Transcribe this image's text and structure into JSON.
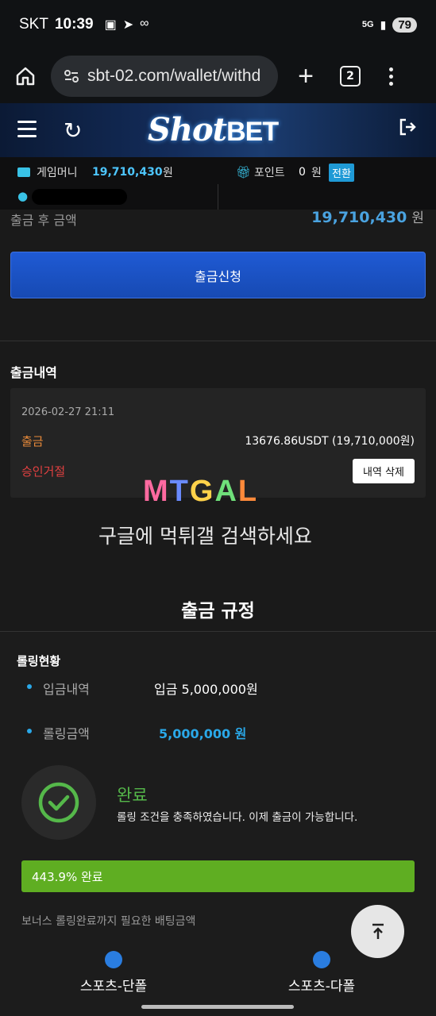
{
  "status_bar": {
    "carrier": "SKT",
    "time": "10:39",
    "network": "5G",
    "battery": "79"
  },
  "browser": {
    "url": "sbt-02.com/wallet/withd",
    "tab_count": "2"
  },
  "header": {
    "logo_shot": "Shot",
    "logo_bet": "BET"
  },
  "balance": {
    "game_money_label": "게임머니",
    "game_money_value": "19,710,430",
    "game_money_unit": "원",
    "point_label": "포인트",
    "point_value": "0",
    "point_unit": "원",
    "convert_label": "전환"
  },
  "withdraw": {
    "after_label": "출금 후 금액",
    "after_value": "19,710,430",
    "after_unit": "원",
    "button_label": "출금신청"
  },
  "history": {
    "title": "출금내역",
    "items": [
      {
        "date": "2026-02-27 21:11",
        "type": "출금",
        "amount": "13676.86USDT (19,710,000원)",
        "status": "승인거절",
        "delete_label": "내역 삭제"
      }
    ]
  },
  "watermark": {
    "logo": "MTGAL",
    "text": "구글에 먹튀갤 검색하세요"
  },
  "rules": {
    "title": "출금 규정",
    "rolling_title": "롤링현황",
    "deposit_label": "입금내역",
    "deposit_value": "입금 5,000,000원",
    "rolling_label": "롤링금액",
    "rolling_value": "5,000,000 원",
    "done_title": "완료",
    "done_desc": "롤링 조건을 충족하였습니다. 이제 출금이 가능합니다.",
    "progress_text": "443.9% 완료",
    "progress_fraction": 1.0,
    "bonus_note": "보너스 롤링완료까지 필요한 배팅금액",
    "accent_color": "#5fae22"
  },
  "bottom_nav": [
    {
      "label": "스포츠-단폴",
      "icon": "volleyball-icon"
    },
    {
      "label": "스포츠-다폴",
      "icon": "football-icon"
    }
  ]
}
